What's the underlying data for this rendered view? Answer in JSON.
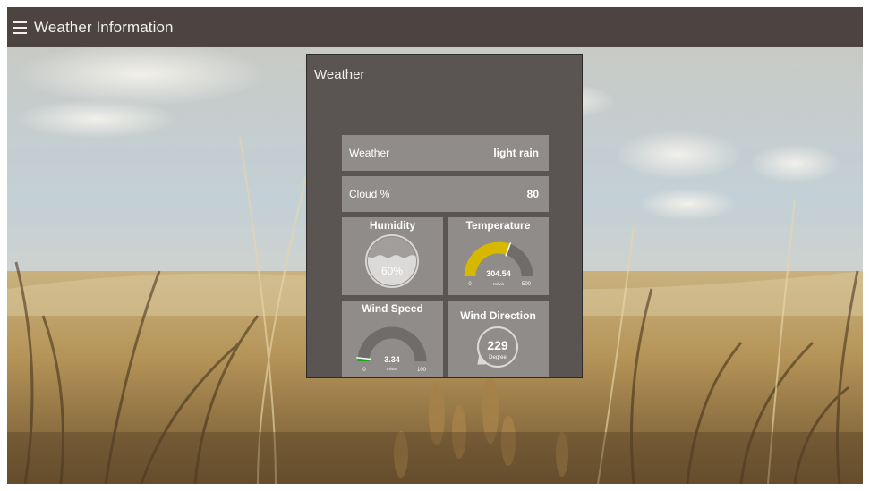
{
  "app": {
    "title": "Weather Information",
    "menu_icon": "hamburger-menu-icon"
  },
  "card": {
    "title": "Weather",
    "rows": [
      {
        "label": "Weather",
        "value": "light rain"
      },
      {
        "label": "Cloud %",
        "value": "80"
      }
    ]
  },
  "gauges": {
    "humidity": {
      "title": "Humidity",
      "value_text": "60%",
      "level": 60,
      "max": 100
    },
    "temperature": {
      "title": "Temperature",
      "value_text": "304.54",
      "units": "Kelvin",
      "min_text": "0",
      "max_text": "500",
      "value": 304.54,
      "min": 0,
      "max": 500,
      "color": "#d6b800"
    },
    "wind_speed": {
      "title": "Wind Speed",
      "value_text": "3.34",
      "units": "m/sec",
      "min_text": "0",
      "max_text": "100",
      "value": 3.34,
      "min": 0,
      "max": 100,
      "color": "#1ca81c"
    },
    "wind_direction": {
      "title": "Wind Direction",
      "value_text": "229",
      "units": "Degree",
      "value": 229
    }
  },
  "colors": {
    "topbar": "#4d4341",
    "card": "#5a5552",
    "tile": "#8f8c8a",
    "gauge_track": "#6f6c6a"
  }
}
